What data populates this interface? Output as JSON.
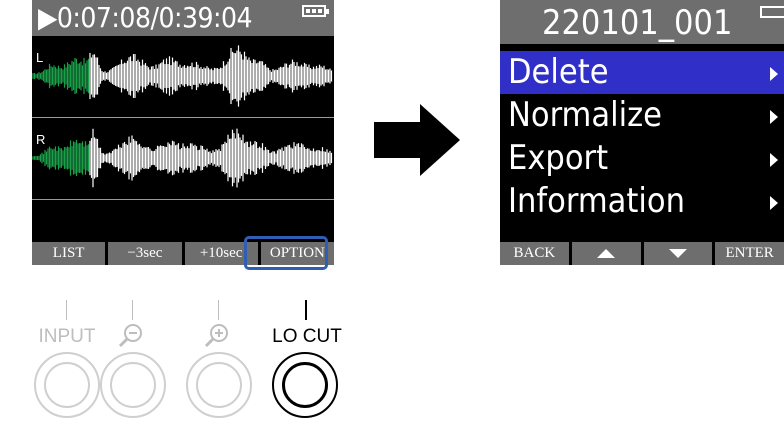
{
  "left_screen": {
    "status": "▶0:07:08/0:39:04",
    "channels": {
      "left": "L",
      "right": "R"
    },
    "function_buttons": [
      "LIST",
      "−3sec",
      "+10sec",
      "OPTION"
    ],
    "highlighted_button": "OPTION",
    "colors": {
      "played_wave": "#1aa04a",
      "remaining_wave": "#ffffff",
      "highlight": "#2f5fb5"
    }
  },
  "hardware_buttons": [
    {
      "label": "INPUT",
      "icon": "none",
      "active": false
    },
    {
      "label": "",
      "icon": "zoom-out-icon",
      "active": false
    },
    {
      "label": "",
      "icon": "zoom-in-icon",
      "active": false
    },
    {
      "label": "LO CUT",
      "icon": "none",
      "active": true
    }
  ],
  "right_screen": {
    "title": "220101_001",
    "menu_items": [
      "Delete",
      "Normalize",
      "Export",
      "Information"
    ],
    "selected_item": "Delete",
    "function_buttons": [
      "BACK",
      "up-arrow-icon",
      "down-arrow-icon",
      "ENTER"
    ],
    "colors": {
      "selection": "#3030c8"
    }
  }
}
